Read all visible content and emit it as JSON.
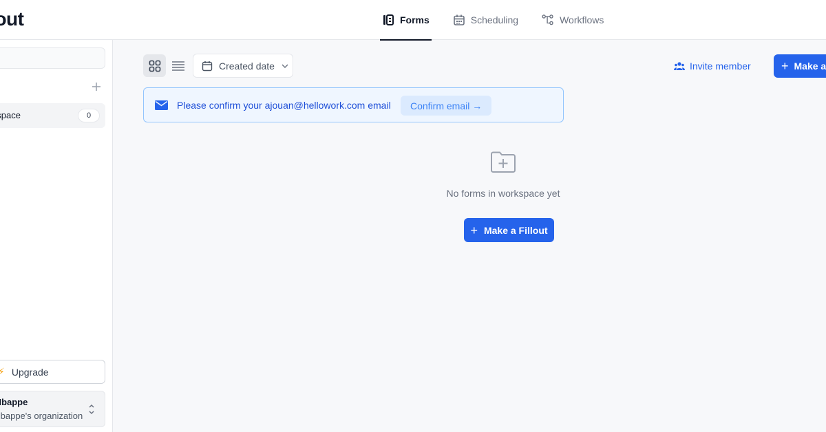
{
  "app": {
    "brand": "Fillout"
  },
  "nav": {
    "tabs": [
      {
        "label": "Forms",
        "icon": "forms-icon",
        "active": true
      },
      {
        "label": "Scheduling",
        "icon": "calendar-icon",
        "active": false
      },
      {
        "label": "Workflows",
        "icon": "workflow-icon",
        "active": false
      }
    ]
  },
  "sidebar": {
    "workspace": {
      "label": "My Workspace",
      "count": "0"
    },
    "upgrade_label": "Upgrade",
    "account": {
      "name": "Jean Mbappe",
      "org": "Jean Mbappe's organization"
    }
  },
  "toolbar": {
    "sort_label": "Created date",
    "invite_label": "Invite member",
    "make_label": "Make a Fillout"
  },
  "banner": {
    "text": "Please confirm your ajouan@hellowork.com email",
    "button": "Confirm email →"
  },
  "empty_state": {
    "text": "No forms in workspace yet",
    "button": "Make a Fillout"
  },
  "colors": {
    "accent": "#2563eb",
    "banner_bg": "#eff6ff",
    "upgrade_bolt": "#f59e0b"
  }
}
